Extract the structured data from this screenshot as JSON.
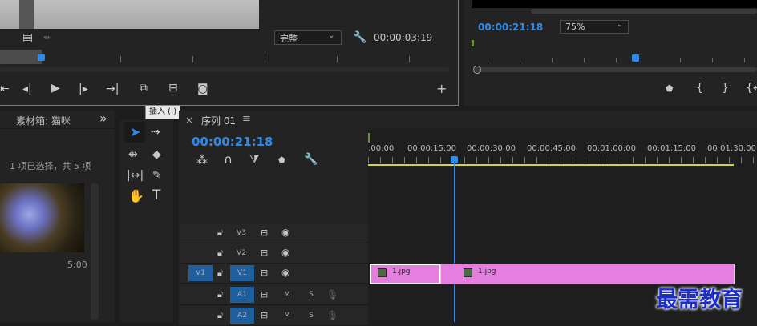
{
  "source_monitor": {
    "quality_select": "完整",
    "timecode": "00:00:03:19"
  },
  "program_monitor": {
    "timecode": "00:00:21:18",
    "zoom_select": "75%"
  },
  "tooltip": {
    "text": "插入 (,)"
  },
  "bin": {
    "title": "素材箱: 猫咪",
    "expand_glyph": "»",
    "selection_status": "1 项已选择，共 5 项",
    "clip_duration": "5:00"
  },
  "timeline": {
    "close_glyph": "×",
    "sequence_name": "序列 01",
    "menu_glyph": "≡",
    "playhead_timecode": "00:00:21:18",
    "ruler_labels": [
      ":00:00",
      "00:00:15:00",
      "00:00:30:00",
      "00:00:45:00",
      "00:01:00:00",
      "00:01:15:00",
      "00:01:30:00"
    ],
    "tracks": [
      {
        "name": "V3",
        "toggle": "",
        "eye": true
      },
      {
        "name": "V2",
        "toggle": "",
        "eye": true
      },
      {
        "name": "V1",
        "toggle": "V1",
        "eye": true
      },
      {
        "name": "A1",
        "toggle": "",
        "m": "M",
        "s": "S"
      },
      {
        "name": "A2",
        "toggle": "",
        "m": "M",
        "s": "S"
      }
    ],
    "clips": [
      {
        "label": "1.jpg"
      },
      {
        "label": "1.jpg"
      }
    ]
  },
  "watermark": {
    "text": "最需教育"
  },
  "colors": {
    "accent_blue": "#2d8ceb",
    "clip_pink": "#e47fe0",
    "work_area_yellow": "#d8d23a",
    "panel_bg": "#232323"
  },
  "icons": [
    "step-back-icon",
    "step-frame-back-icon",
    "play-icon",
    "step-frame-forward-icon",
    "go-to-out-icon",
    "insert-icon",
    "overwrite-icon",
    "camera-icon",
    "add-icon",
    "wrench-icon",
    "selection-tool-icon",
    "track-select-icon",
    "ripple-edit-icon",
    "razor-icon",
    "slip-icon",
    "pen-icon",
    "hand-icon",
    "type-icon",
    "snap-icon",
    "linked-selection-icon",
    "marker-icon",
    "lock-icon",
    "eye-icon",
    "mic-icon"
  ]
}
